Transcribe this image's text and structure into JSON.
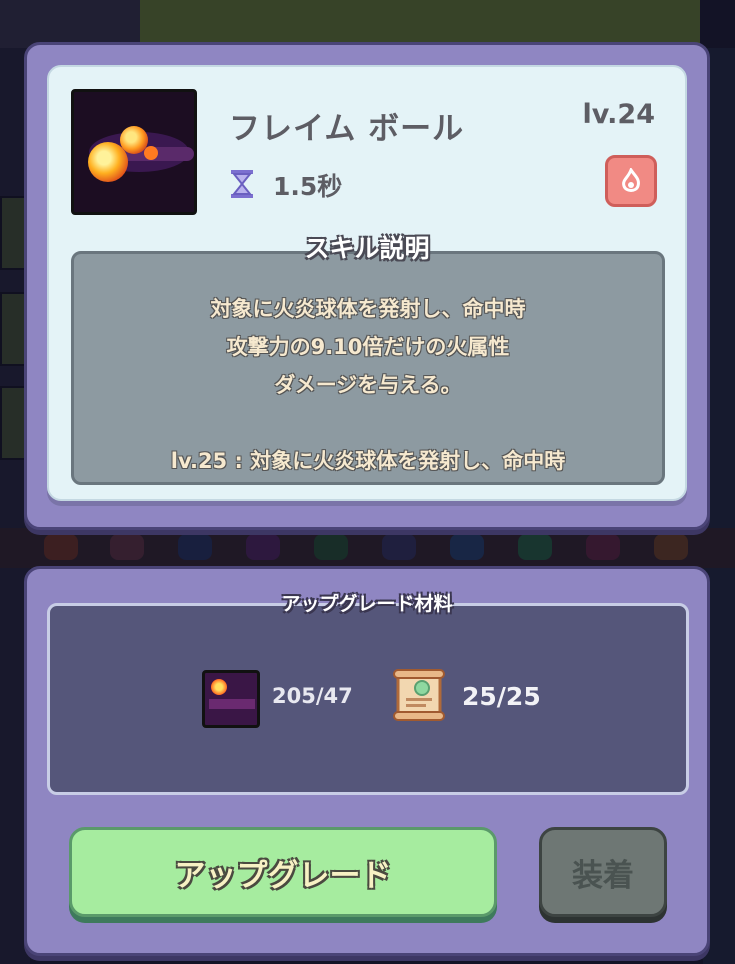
{
  "skill": {
    "name": "フレイム ボール",
    "level": "lv.24",
    "cooldown": "1.5秒",
    "icon": "flame-ball-icon",
    "element_icon": "fire-element-icon"
  },
  "description": {
    "title": "スキル説明",
    "lines": [
      "対象に火炎球体を発射し、命中時",
      "攻撃力の9.10倍だけの火属性",
      "ダメージを与える。"
    ],
    "next_level_line": "lv.25 : 対象に火炎球体を発射し、命中時"
  },
  "materials": {
    "title": "アップグレード材料",
    "items": [
      {
        "icon": "skill-card-icon",
        "count": "205/47"
      },
      {
        "icon": "scroll-icon",
        "count": "25/25"
      }
    ]
  },
  "buttons": {
    "upgrade": "アップグレード",
    "equip": "装着"
  },
  "colors": {
    "panel": "#8f86c2",
    "card": "#e4f3f7",
    "upgrade_button": "#a6ec9f",
    "equip_button": "#6e7774",
    "fire_badge": "#f18a84"
  }
}
